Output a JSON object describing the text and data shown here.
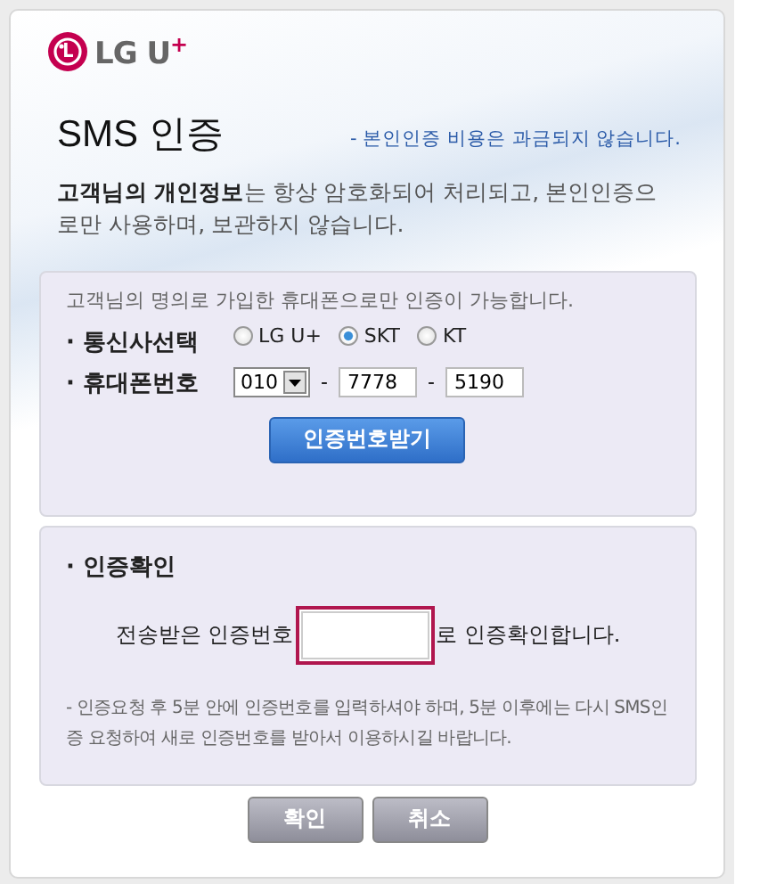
{
  "brand": {
    "name": "LG U$^{+}$"
  },
  "title": "SMS 인증",
  "notice": "- 본인인증 비용은 과금되지  않습니다.",
  "intro": "**고객님의 개인정보**는 항상 암호화되어 처리되고, 본인인증으로만 사용하며, 보관하지 않습니다.",
  "request": {
    "hint": "고객님의 명의로 가입한 휴대폰으로만 인증이 가능합니다.",
    "carrier_label": "· 통신사선택",
    "carriers": [
      {
        "label": "LG U+",
        "selected": false
      },
      {
        "label": "SKT",
        "selected": true
      },
      {
        "label": "KT",
        "selected": false
      }
    ],
    "phone_label": "· 휴대폰번호",
    "prefix": "010",
    "separator_1": "-",
    "middle": "7778",
    "separator_2": "-",
    "last": "5190",
    "button": "인증번호받기"
  },
  "verify": {
    "heading": "· 인증확인",
    "before": "전송받은 인증번호",
    "after": "로 인증확인합니다.",
    "note": "- 인증요청 후 5분 안에 인증번호를 입력하셔야 하며, 5분 이후에는 다시 SMS인증 요청하여 새로 인증번호를 받아서 이용하시길 바랍니다."
  },
  "buttons": [
    "확인",
    "취소"
  ]
}
